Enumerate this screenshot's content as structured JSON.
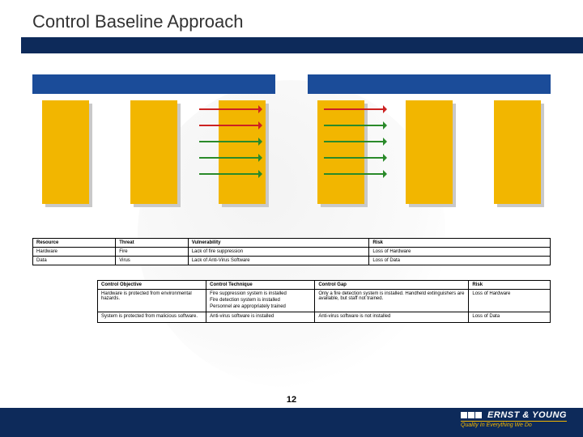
{
  "title": "Control Baseline Approach",
  "page_number": "12",
  "table_a": {
    "headers": [
      "Resource",
      "Threat",
      "Vulnerability",
      "Risk"
    ],
    "rows": [
      [
        "Hardware",
        "Fire",
        "Lack of fire suppression",
        "Loss of Hardware"
      ],
      [
        "Data",
        "Virus",
        "Lack of Anti-Virus Software",
        "Loss of Data"
      ]
    ]
  },
  "table_b": {
    "headers": [
      "Control Objective",
      "Control Technique",
      "Control Gap",
      "Risk"
    ],
    "rows": [
      {
        "objective": "Hardware is protected from environmental hazards.",
        "techniques": [
          "Fire suppression system is installed",
          "Fire detection system is installed",
          "Personnel are appropriately trained"
        ],
        "gap": "Only a fire detection system is installed. Handheld extinguishers are available, but staff not trained.",
        "risk": "Loss of Hardware"
      },
      {
        "objective": "System is protected from malicious software.",
        "techniques": [
          "Anti-virus software is installed"
        ],
        "gap": "Anti-virus software is not installed",
        "risk": "Loss of Data"
      }
    ]
  },
  "brand": {
    "name": "ERNST & YOUNG",
    "tagline": "Quality In Everything We Do"
  }
}
